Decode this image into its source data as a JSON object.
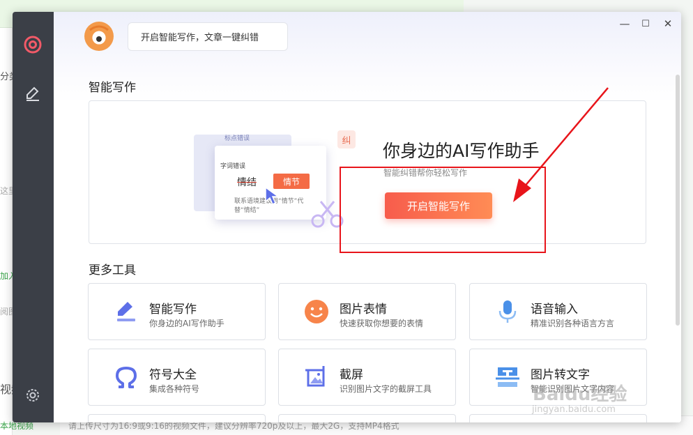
{
  "background": {
    "fragments": [
      "分类",
      "这里输入商",
      "加入管引用",
      "阅图片与管",
      "视频",
      "本地视频"
    ],
    "bottom_hint": "请上传尺寸为16:9或9:16的视频文件，建议分辨率720p及以上，最大2G，支持MP4格式"
  },
  "header": {
    "bubble_text": "开启智能写作，文章一键纠错"
  },
  "window_controls": {
    "minimize": "—",
    "maximize": "☐",
    "close": "✕"
  },
  "section_writing": {
    "title": "智能写作"
  },
  "banner": {
    "title": "你身边的AI写作助手",
    "subtitle": "智能纠错帮你轻松写作",
    "button_label": "开启智能写作",
    "illustration": {
      "chip": "标点错误",
      "label": "字词错误",
      "wrong_word": "情结",
      "right_word": "情节",
      "note": "联系语境建议用“情节”代替“情结”",
      "badge": "纠"
    }
  },
  "section_tools": {
    "title": "更多工具"
  },
  "tools": [
    {
      "name": "智能写作",
      "desc": "你身边的AI写作助手",
      "icon": "pen-icon"
    },
    {
      "name": "图片表情",
      "desc": "快速获取你想要的表情",
      "icon": "emoji-icon"
    },
    {
      "name": "语音输入",
      "desc": "精准识别各种语言方言",
      "icon": "microphone-icon"
    },
    {
      "name": "符号大全",
      "desc": "集成各种符号",
      "icon": "omega-icon"
    },
    {
      "name": "截屏",
      "desc": "识别图片文字的截屏工具",
      "icon": "screenshot-icon"
    },
    {
      "name": "图片转文字",
      "desc": "智能识别图片文字内容",
      "icon": "ocr-icon"
    }
  ],
  "watermark": {
    "main": "Baidu经验",
    "sub": "jingyan.baidu.com"
  },
  "colors": {
    "accent": "#f75c4c",
    "rail": "#3b3f47",
    "annotation": "#e8141a",
    "tool_blue": "#5d6fe8"
  }
}
